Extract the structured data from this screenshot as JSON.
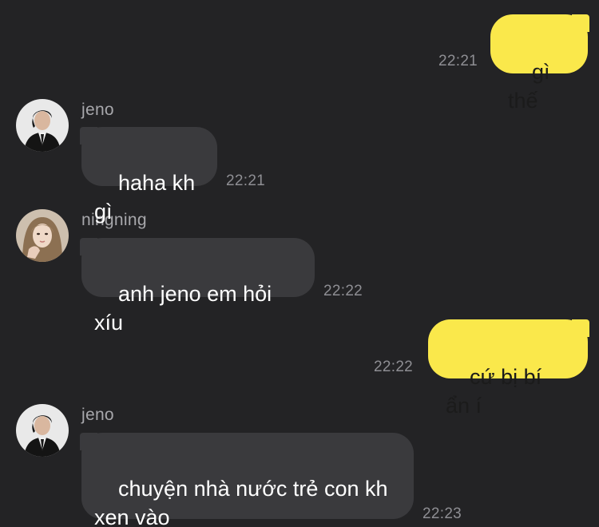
{
  "messages": [
    {
      "type": "outgoing",
      "text": "gì thế",
      "time": "22:21"
    },
    {
      "type": "incoming",
      "sender": "jeno",
      "avatar": "jeno-avatar",
      "text": "haha kh gì",
      "time": "22:21"
    },
    {
      "type": "incoming",
      "sender": "ningning",
      "avatar": "ningning-avatar",
      "text": "anh jeno em hỏi xíu",
      "time": "22:22"
    },
    {
      "type": "outgoing",
      "text": "cứ bị bí ẩn í",
      "time": "22:22"
    },
    {
      "type": "incoming",
      "sender": "jeno",
      "avatar": "jeno-avatar",
      "text": "chuyện nhà nước trẻ con kh\nxen vào",
      "time": "22:23"
    }
  ],
  "colors": {
    "background": "#232325",
    "incoming_bubble": "#3a3a3d",
    "outgoing_bubble": "#fae84b",
    "timestamp": "#8e8e93"
  }
}
